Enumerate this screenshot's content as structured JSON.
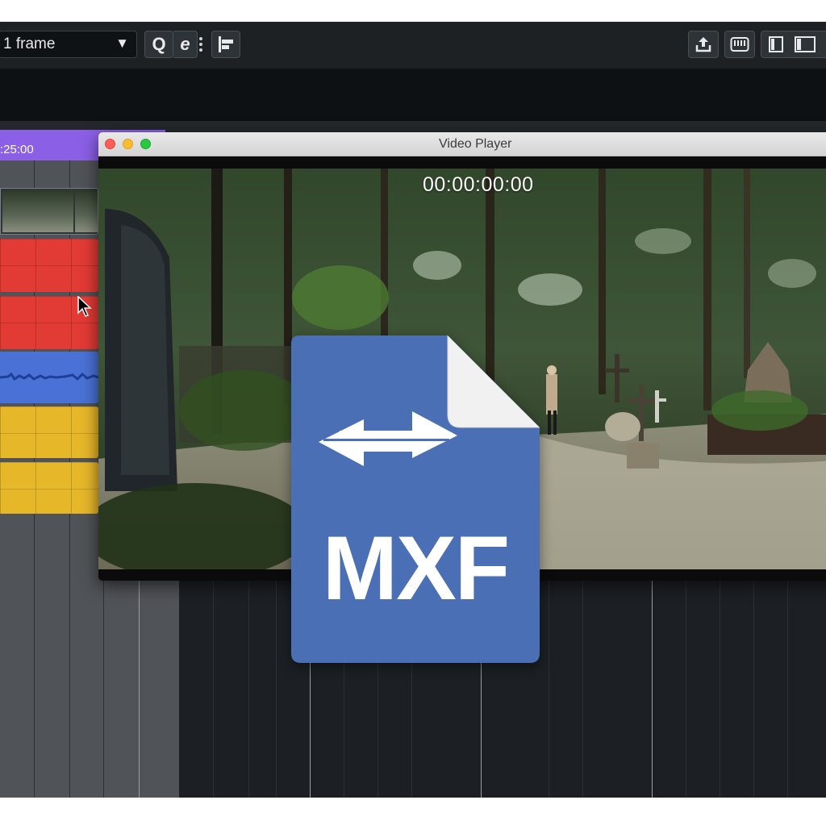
{
  "toolbar": {
    "snap_value": "1 frame",
    "snap_caret": "▼",
    "quantize_label": "Q",
    "edit_label": "e",
    "icons": [
      "align-left-icon",
      "export-icon",
      "keyboard-icon",
      "panel-left-icon",
      "panel-right-icon"
    ]
  },
  "timeline": {
    "ruler_time": ":25:00",
    "track_colors": {
      "video": "#303538",
      "red": "#e23a35",
      "blue": "#4a72d6",
      "yellow": "#e7b72a",
      "marker": "#8b5fe6"
    }
  },
  "player": {
    "title": "Video Player",
    "timecode": "00:00:00:00"
  },
  "overlay": {
    "label": "MXF",
    "icon": "file-convert-icon",
    "color": "#4a6fb5"
  }
}
